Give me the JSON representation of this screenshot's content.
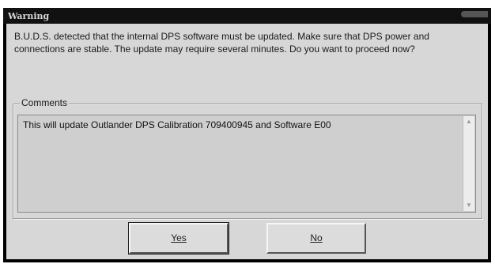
{
  "window": {
    "title": "Warning"
  },
  "message": "B.U.D.S. detected that the internal DPS software must be updated. Make sure that DPS power and connections are stable. The update may require several minutes. Do you want to proceed now?",
  "comments": {
    "legend": "Comments",
    "text": "This will update Outlander DPS Calibration 709400945 and Software E00",
    "scroll_up": "▲",
    "scroll_down": "▼"
  },
  "buttons": {
    "yes": "Yes",
    "no": "No"
  }
}
